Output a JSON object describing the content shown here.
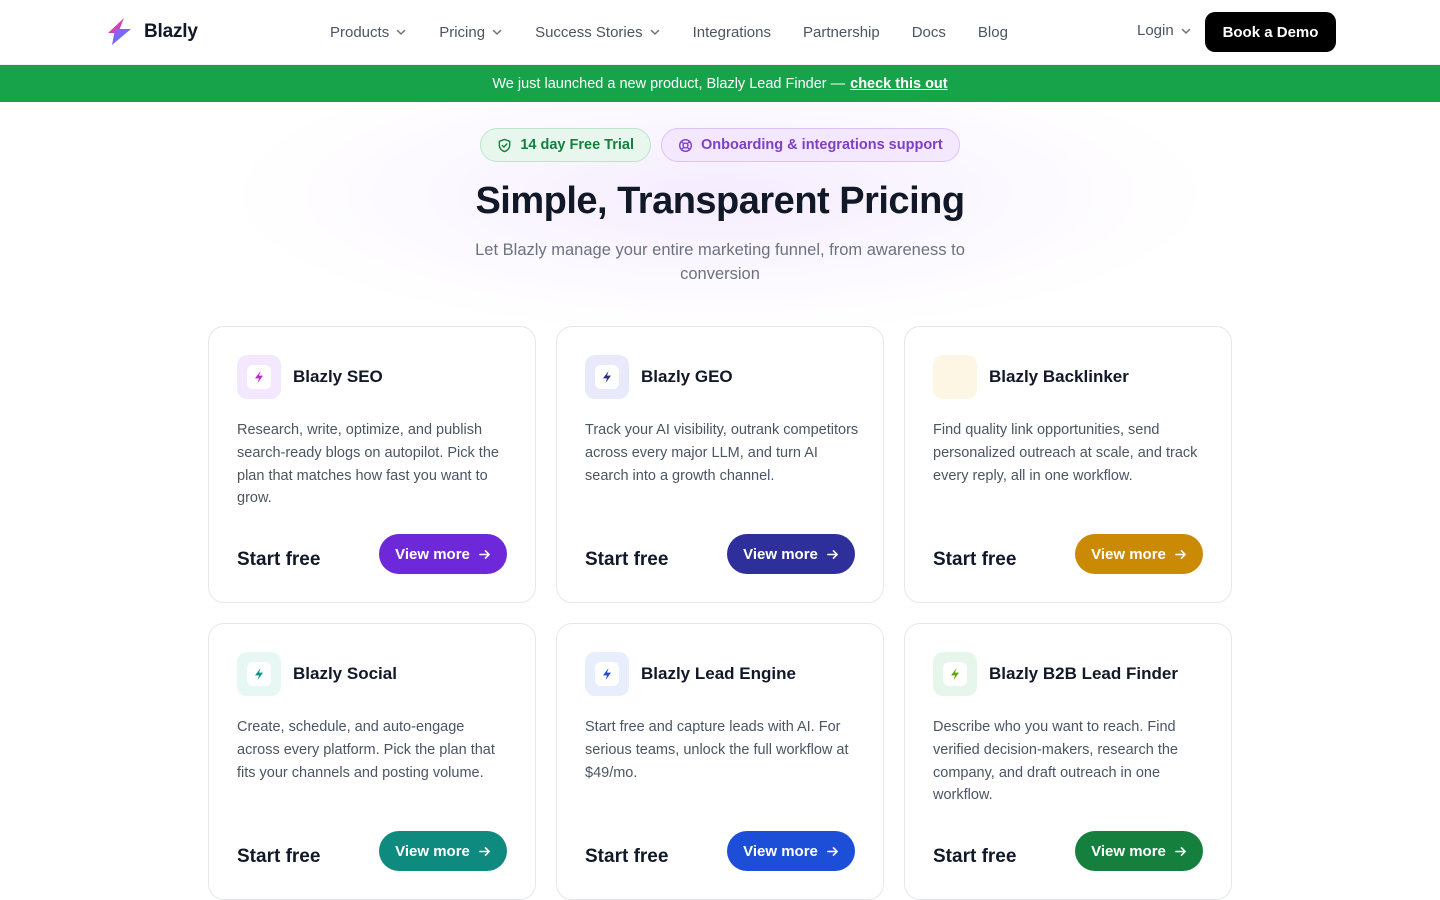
{
  "brand": {
    "name": "Blazly"
  },
  "nav": [
    {
      "label": "Products",
      "dropdown": true
    },
    {
      "label": "Pricing",
      "dropdown": true
    },
    {
      "label": "Success Stories",
      "dropdown": true
    },
    {
      "label": "Integrations",
      "dropdown": false
    },
    {
      "label": "Partnership",
      "dropdown": false
    },
    {
      "label": "Docs",
      "dropdown": false
    },
    {
      "label": "Blog",
      "dropdown": false
    }
  ],
  "header": {
    "login_label": "Login",
    "demo_label": "Book a Demo"
  },
  "banner": {
    "text": "We just launched a new product, Blazly Lead Finder —",
    "link": "check this out"
  },
  "hero": {
    "pill_trial": "14 day Free Trial",
    "pill_support": "Onboarding & integrations support",
    "title": "Simple, Transparent Pricing",
    "subtitle": "Let Blazly manage your entire marketing funnel, from awareness to conversion"
  },
  "cards": [
    {
      "name": "Blazly SEO",
      "desc": "Research, write, optimize, and publish search-ready blogs on autopilot. Pick the plan that matches how fast you want to grow.",
      "start": "Start free",
      "button": "View more",
      "color": "#6d28d9",
      "tint": "#f3e8ff",
      "icon_color": "#c026d3",
      "icon": "bolt-icon"
    },
    {
      "name": "Blazly GEO",
      "desc": "Track your AI visibility, outrank competitors across every major LLM, and turn AI search into a growth channel.",
      "start": "Start free",
      "button": "View more",
      "color": "#2e2f9a",
      "tint": "#e8e9fb",
      "icon_color": "#312e81",
      "icon": "bolt-icon"
    },
    {
      "name": "Blazly Backlinker",
      "desc": "Find quality link opportunities, send personalized outreach at scale, and track every reply, all in one workflow.",
      "start": "Start free",
      "button": "View more",
      "color": "#ca8a04",
      "tint": "#fef6e4",
      "icon_color": "#fef6e4",
      "icon": "bolt-icon"
    },
    {
      "name": "Blazly Social",
      "desc": "Create, schedule, and auto-engage across every platform. Pick the plan that fits your channels and posting volume.",
      "start": "Start free",
      "button": "View more",
      "color": "#0f8a7e",
      "tint": "#e6f7f4",
      "icon_color": "#0d9488",
      "icon": "bolt-icon"
    },
    {
      "name": "Blazly Lead Engine",
      "desc": "Start free and capture leads with AI. For serious teams, unlock the full workflow at $49/mo.",
      "start": "Start free",
      "button": "View more",
      "color": "#1d4ed8",
      "tint": "#e8eefc",
      "icon_color": "#1d4ed8",
      "icon": "bolt-icon"
    },
    {
      "name": "Blazly B2B Lead Finder",
      "desc": "Describe who you want to reach. Find verified decision-makers, research the company, and draft outreach in one workflow.",
      "start": "Start free",
      "button": "View more",
      "color": "#15803d",
      "tint": "#e6f6ea",
      "icon_color": "#65a30d",
      "icon": "bolt-icon"
    }
  ]
}
